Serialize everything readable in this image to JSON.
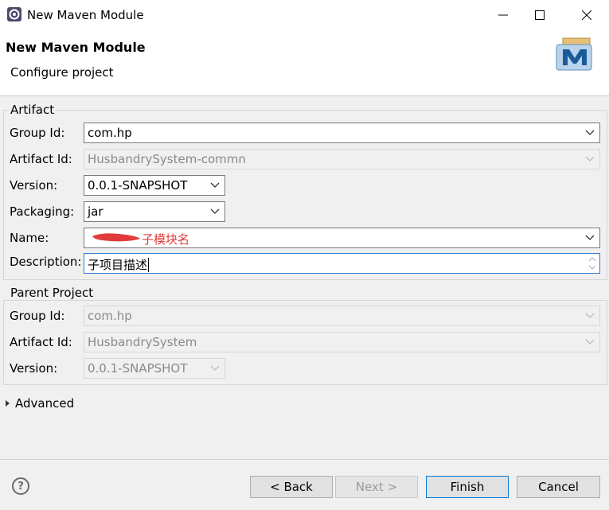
{
  "window": {
    "title": "New Maven Module"
  },
  "header": {
    "title": "New Maven Module",
    "subtitle": "Configure project"
  },
  "artifact": {
    "section_title": "Artifact",
    "group_id_label": "Group Id:",
    "group_id_value": "com.hp",
    "artifact_id_label": "Artifact Id:",
    "artifact_id_value": "HusbandrySystem-commn",
    "version_label": "Version:",
    "version_value": "0.0.1-SNAPSHOT",
    "packaging_label": "Packaging:",
    "packaging_value": "jar",
    "name_label": "Name:",
    "name_value": "子模块名",
    "description_label": "Description:",
    "description_value": "子项目描述"
  },
  "parent": {
    "section_title": "Parent Project",
    "group_id_label": "Group Id:",
    "group_id_value": "com.hp",
    "artifact_id_label": "Artifact Id:",
    "artifact_id_value": "HusbandrySystem",
    "version_label": "Version:",
    "version_value": "0.0.1-SNAPSHOT"
  },
  "advanced": {
    "label": "Advanced"
  },
  "footer": {
    "help_glyph": "?",
    "back_label": "< Back",
    "next_label": "Next >",
    "finish_label": "Finish",
    "cancel_label": "Cancel"
  },
  "colors": {
    "accent": "#0078d7",
    "annotation": "#e23b3b"
  }
}
